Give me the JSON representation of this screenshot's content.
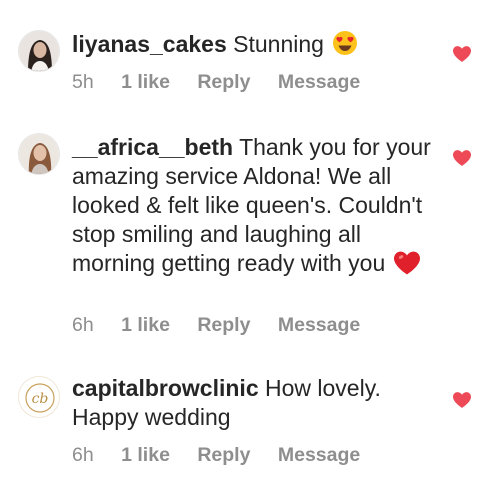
{
  "colors": {
    "text": "#262626",
    "meta": "#8e8e8e",
    "heart": "#ed4956"
  },
  "comments": [
    {
      "username": "liyanas_cakes",
      "text": "Stunning",
      "emoji": "heart-eyes-emoji",
      "time": "5h",
      "likes": "1 like",
      "reply": "Reply",
      "message": "Message",
      "liked": true
    },
    {
      "username": "__africa__beth",
      "text": "Thank you for your amazing service Aldona! We all looked & felt like queen's. Couldn't stop smiling and laughing all morning getting ready with you",
      "emoji": "red-heart-emoji",
      "time": "6h",
      "likes": "1 like",
      "reply": "Reply",
      "message": "Message",
      "liked": true
    },
    {
      "username": "capitalbrowclinic",
      "text": "How lovely. Happy wedding",
      "avatar_monogram": "cb",
      "time": "6h",
      "likes": "1 like",
      "reply": "Reply",
      "message": "Message",
      "liked": true
    }
  ]
}
